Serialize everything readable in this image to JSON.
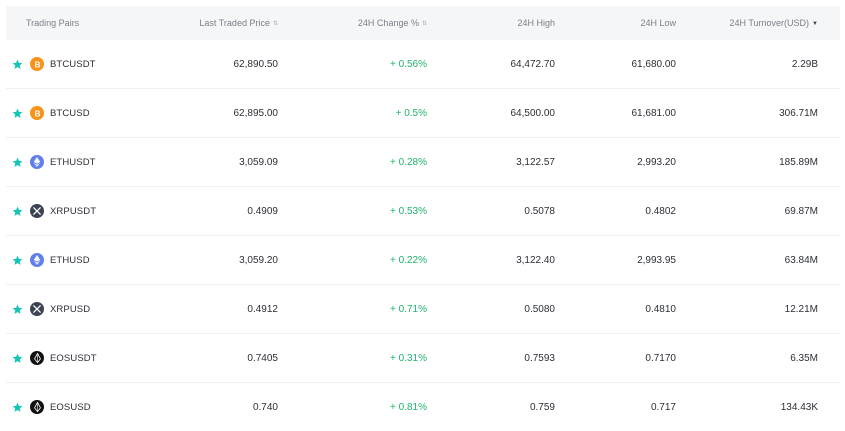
{
  "columns": [
    {
      "key": "pair",
      "label": "Trading Pairs",
      "sort": ""
    },
    {
      "key": "last",
      "label": "Last Traded Price",
      "sort": "⇅"
    },
    {
      "key": "change",
      "label": "24H Change %",
      "sort": "⇅"
    },
    {
      "key": "high",
      "label": "24H High",
      "sort": ""
    },
    {
      "key": "low",
      "label": "24H Low",
      "sort": ""
    },
    {
      "key": "turnover",
      "label": "24H Turnover(USD)",
      "sort": "▼"
    }
  ],
  "colors": {
    "star": "#16c5b5",
    "up": "#20b26c",
    "btc": "#f7931a",
    "eth": "#627eea",
    "xrp": "#3b4352",
    "eos": "#111111"
  },
  "rows": [
    {
      "icon": "btc-icon",
      "pair": "BTCUSDT",
      "last": "62,890.50",
      "change": "+ 0.56%",
      "high": "64,472.70",
      "low": "61,680.00",
      "turnover": "2.29B"
    },
    {
      "icon": "btc-icon",
      "pair": "BTCUSD",
      "last": "62,895.00",
      "change": "+ 0.5%",
      "high": "64,500.00",
      "low": "61,681.00",
      "turnover": "306.71M"
    },
    {
      "icon": "eth-icon",
      "pair": "ETHUSDT",
      "last": "3,059.09",
      "change": "+ 0.28%",
      "high": "3,122.57",
      "low": "2,993.20",
      "turnover": "185.89M"
    },
    {
      "icon": "xrp-icon",
      "pair": "XRPUSDT",
      "last": "0.4909",
      "change": "+ 0.53%",
      "high": "0.5078",
      "low": "0.4802",
      "turnover": "69.87M"
    },
    {
      "icon": "eth-icon",
      "pair": "ETHUSD",
      "last": "3,059.20",
      "change": "+ 0.22%",
      "high": "3,122.40",
      "low": "2,993.95",
      "turnover": "63.84M"
    },
    {
      "icon": "xrp-icon",
      "pair": "XRPUSD",
      "last": "0.4912",
      "change": "+ 0.71%",
      "high": "0.5080",
      "low": "0.4810",
      "turnover": "12.21M"
    },
    {
      "icon": "eos-icon",
      "pair": "EOSUSDT",
      "last": "0.7405",
      "change": "+ 0.31%",
      "high": "0.7593",
      "low": "0.7170",
      "turnover": "6.35M"
    },
    {
      "icon": "eos-icon",
      "pair": "EOSUSD",
      "last": "0.740",
      "change": "+ 0.81%",
      "high": "0.759",
      "low": "0.717",
      "turnover": "134.43K"
    }
  ]
}
